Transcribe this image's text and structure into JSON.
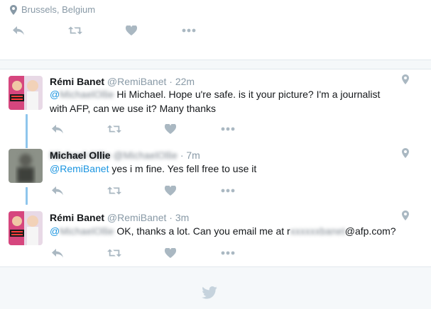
{
  "top": {
    "location": "Brussels, Belgium"
  },
  "tweets": [
    {
      "display_name": "Rémi Banet",
      "handle": "@RemiBanet",
      "time": "· 22m",
      "mention": "@",
      "text": "Hi Michael. Hope u're safe. is it your picture? I'm a journalist with AFP, can we use it? Many thanks"
    },
    {
      "display_name": "",
      "handle": "",
      "time": "· 7m",
      "mention": "@RemiBanet",
      "text": "yes i m fine. Yes fell free to use it"
    },
    {
      "display_name": "Rémi Banet",
      "handle": "@RemiBanet",
      "time": "· 3m",
      "mention": "@",
      "text_before": "OK, thanks a lot. Can you email me at r",
      "text_after": "@afp.com?"
    }
  ],
  "colors": {
    "brand": "#1b95e0",
    "muted": "#8899a6",
    "thread": "#8ec5ec",
    "icon": "#aab8c2"
  }
}
